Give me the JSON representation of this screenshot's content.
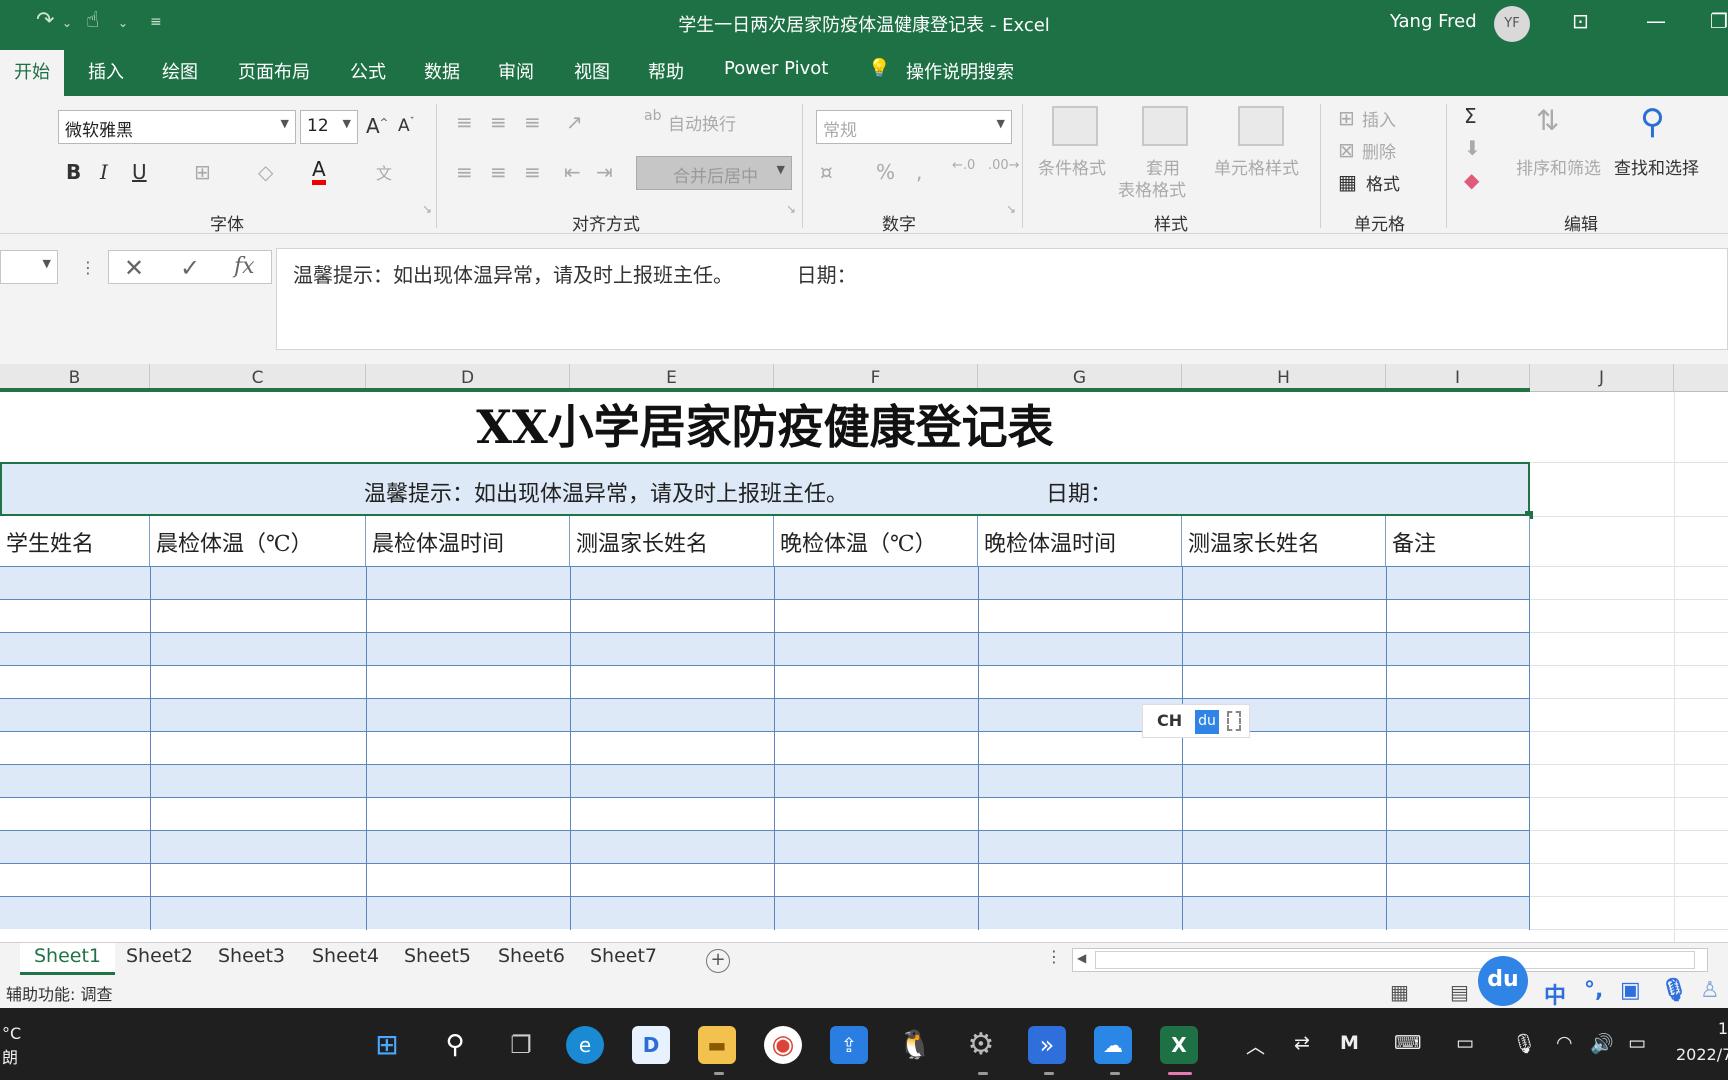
{
  "titlebar": {
    "title": "学生一日两次居家防疫体温健康登记表  -  Excel",
    "user": "Yang Fred",
    "avatar": "YF"
  },
  "ribbon_tabs": [
    "开始",
    "插入",
    "绘图",
    "页面布局",
    "公式",
    "数据",
    "审阅",
    "视图",
    "帮助",
    "Power Pivot",
    "操作说明搜索"
  ],
  "ribbon": {
    "font_name": "微软雅黑",
    "font_size": "12",
    "groups": {
      "font": "字体",
      "alignment": "对齐方式",
      "number": "数字",
      "styles": "样式",
      "cells": "单元格",
      "editing": "编辑"
    },
    "wrap_text": "自动换行",
    "merge_center": "合并后居中",
    "number_format": "常规",
    "percent": "%",
    "conditional_format": "条件格式",
    "table_format_1": "套用",
    "table_format_2": "表格格式",
    "cell_style": "单元格样式",
    "insert": "插入",
    "delete": "删除",
    "format": "格式",
    "sort_filter": "排序和筛选",
    "find_select": "查找和选择"
  },
  "formula_bar": {
    "content": "温馨提示：如出现体温异常，请及时上报班主任。          日期："
  },
  "columns": [
    "B",
    "C",
    "D",
    "E",
    "F",
    "G",
    "H",
    "I",
    "J"
  ],
  "sheet": {
    "title": "XX小学居家防疫健康登记表",
    "tip": "温馨提示：如出现体温异常，请及时上报班主任。",
    "date_label": "日期：",
    "headers": [
      "学生姓名",
      "晨检体温（℃）",
      "晨检体温时间",
      "测温家长姓名",
      "晚检体温（℃）",
      "晚检体温时间",
      "测温家长姓名",
      "备注"
    ]
  },
  "ime_float": {
    "ch": "CH",
    "du": "du"
  },
  "sheet_tabs": [
    "Sheet1",
    "Sheet2",
    "Sheet3",
    "Sheet4",
    "Sheet5",
    "Sheet6",
    "Sheet7"
  ],
  "status": {
    "accessibility": "辅助功能: 调查",
    "ime_zh": "中"
  },
  "taskbar": {
    "weather_temp": "°C",
    "weather_desc": "朗",
    "time": "1",
    "date": "2022/7"
  }
}
